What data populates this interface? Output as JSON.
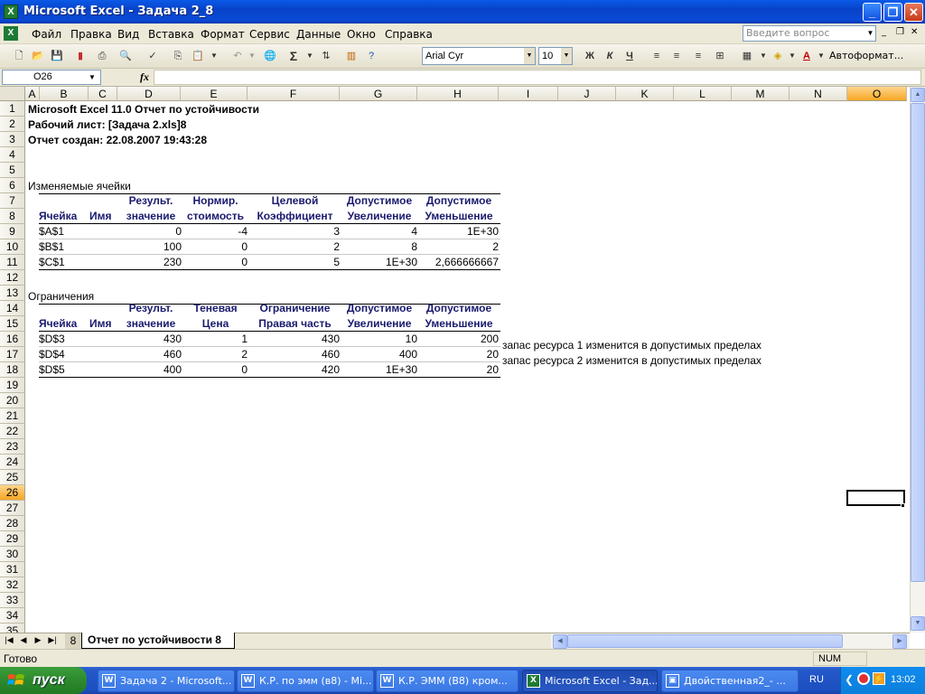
{
  "window": {
    "title": "Microsoft Excel - Задача 2_8",
    "app_icon": "excel-icon"
  },
  "menu": [
    "Файл",
    "Правка",
    "Вид",
    "Вставка",
    "Формат",
    "Сервис",
    "Данные",
    "Окно",
    "Справка"
  ],
  "help_box": {
    "placeholder": "Введите вопрос"
  },
  "toolbar": {
    "font_name": "Arial Cyr",
    "font_size": "10",
    "bold": "Ж",
    "italic": "К",
    "underline": "Ч",
    "autoformat": "Автоформат...",
    "sigma": "Σ"
  },
  "formula_bar": {
    "cell_ref": "O26",
    "fx": "fx",
    "value": ""
  },
  "columns": [
    "A",
    "B",
    "C",
    "D",
    "E",
    "F",
    "G",
    "H",
    "I",
    "J",
    "K",
    "L",
    "M",
    "N",
    "O"
  ],
  "selected": {
    "column": "O",
    "row": "26"
  },
  "report": {
    "title": "Microsoft Excel 11.0 Отчет по устойчивости",
    "worksheet": "Рабочий лист: [Задача 2.xls]8",
    "created": "Отчет создан: 22.08.2007 19:43:28",
    "section1": {
      "title": "Изменяемые ячейки",
      "header_top": [
        "",
        "",
        "Результ.",
        "Нормир.",
        "Целевой",
        "Допустимое",
        "Допустимое"
      ],
      "header_bottom": [
        "Ячейка",
        "Имя",
        "значение",
        "стоимость",
        "Коэффициент",
        "Увеличение",
        "Уменьшение"
      ],
      "rows": [
        [
          "$A$1",
          "",
          "0",
          "-4",
          "3",
          "4",
          "1E+30"
        ],
        [
          "$B$1",
          "",
          "100",
          "0",
          "2",
          "8",
          "2"
        ],
        [
          "$C$1",
          "",
          "230",
          "0",
          "5",
          "1E+30",
          "2,666666667"
        ]
      ]
    },
    "section2": {
      "title": "Ограничения",
      "header_top": [
        "",
        "",
        "Результ.",
        "Теневая",
        "Ограничение",
        "Допустимое",
        "Допустимое"
      ],
      "header_bottom": [
        "Ячейка",
        "Имя",
        "значение",
        "Цена",
        "Правая часть",
        "Увеличение",
        "Уменьшение"
      ],
      "rows": [
        [
          "$D$3",
          "",
          "430",
          "1",
          "430",
          "10",
          "200"
        ],
        [
          "$D$4",
          "",
          "460",
          "2",
          "460",
          "400",
          "20"
        ],
        [
          "$D$5",
          "",
          "400",
          "0",
          "420",
          "1E+30",
          "20"
        ]
      ],
      "notes": [
        "запас ресурса 1 изменится в допустимых пределах",
        "запас ресурса 2 изменится в допустимых пределах"
      ]
    }
  },
  "sheet_tabs": {
    "other": "8",
    "active": "Отчет по устойчивости 8"
  },
  "status": {
    "text": "Готово",
    "num": "NUM"
  },
  "taskbar": {
    "start": "пуск",
    "tasks": [
      "Задача 2 - Microsoft...",
      "К.Р. по эмм (в8) - Mi...",
      "К.Р. ЭММ (В8) кром...",
      "Microsoft Excel - Зад...",
      "Двойственная2_- ..."
    ],
    "lang": "RU",
    "clock": "13:02"
  }
}
